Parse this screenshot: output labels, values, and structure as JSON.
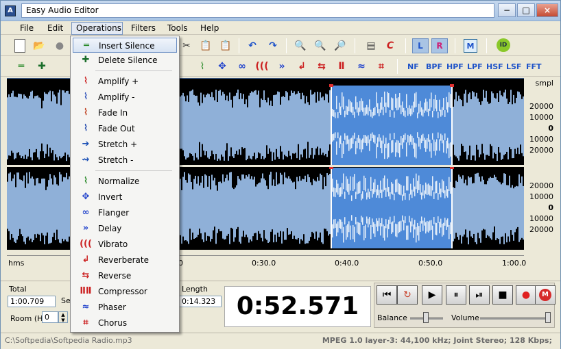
{
  "window": {
    "title": "Easy Audio Editor",
    "app_icon": "A"
  },
  "window_buttons": {
    "minimize": "−",
    "maximize": "□",
    "close": "×"
  },
  "menubar": [
    "File",
    "Edit",
    "Operations",
    "Filters",
    "Tools",
    "Help"
  ],
  "toolbar2_filters": [
    "NF",
    "BPF",
    "HPF",
    "LPF",
    "HSF",
    "LSF",
    "FFT"
  ],
  "channel_buttons": [
    "L",
    "R"
  ],
  "operations_menu": [
    {
      "label": "Insert Silence",
      "icon": "insert-silence-icon",
      "glyph": "═",
      "color": "#2a8a2a"
    },
    {
      "label": "Delete Silence",
      "icon": "delete-silence-icon",
      "glyph": "✚",
      "color": "#1b6e2a"
    },
    {
      "label": "Amplify +",
      "icon": "amplify-plus-icon",
      "glyph": "⌇",
      "color": "#cc2222"
    },
    {
      "label": "Amplify -",
      "icon": "amplify-minus-icon",
      "glyph": "⌇",
      "color": "#3355bb"
    },
    {
      "label": "Fade In",
      "icon": "fade-in-icon",
      "glyph": "⌇",
      "color": "#c04020"
    },
    {
      "label": "Fade Out",
      "icon": "fade-out-icon",
      "glyph": "⌇",
      "color": "#2a4fb0"
    },
    {
      "label": "Stretch +",
      "icon": "stretch-plus-icon",
      "glyph": "➔",
      "color": "#1a4fb5"
    },
    {
      "label": "Stretch -",
      "icon": "stretch-minus-icon",
      "glyph": "⇝",
      "color": "#1a4fb5"
    },
    {
      "label": "Normalize",
      "icon": "normalize-icon",
      "glyph": "⌇",
      "color": "#2a8a2a"
    },
    {
      "label": "Invert",
      "icon": "invert-icon",
      "glyph": "✥",
      "color": "#2244cc"
    },
    {
      "label": "Flanger",
      "icon": "flanger-icon",
      "glyph": "∞",
      "color": "#2244cc"
    },
    {
      "label": "Delay",
      "icon": "delay-icon",
      "glyph": "»",
      "color": "#2244cc"
    },
    {
      "label": "Vibrato",
      "icon": "vibrato-icon",
      "glyph": "(((",
      "color": "#cc2222"
    },
    {
      "label": "Reverberate",
      "icon": "reverberate-icon",
      "glyph": "↲",
      "color": "#cc2222"
    },
    {
      "label": "Reverse",
      "icon": "reverse-icon",
      "glyph": "⇆",
      "color": "#cc2222"
    },
    {
      "label": "Compressor",
      "icon": "compressor-icon",
      "glyph": "ⅡⅡ",
      "color": "#cc2222"
    },
    {
      "label": "Phaser",
      "icon": "phaser-icon",
      "glyph": "≈",
      "color": "#2244cc"
    },
    {
      "label": "Chorus",
      "icon": "chorus-icon",
      "glyph": "⌗",
      "color": "#cc2222"
    }
  ],
  "scale": {
    "unit": "smpl",
    "labels_top": [
      "20000",
      "10000",
      "0",
      "10000",
      "20000"
    ],
    "labels_bottom": [
      "20000",
      "10000",
      "0",
      "10000",
      "20000"
    ]
  },
  "timeline": {
    "unit": "hms",
    "ticks": [
      "0:30.0",
      "0:40.0",
      "0:50.0",
      "1:00.0"
    ],
    "partial_tick": "0"
  },
  "info": {
    "total_label": "Total",
    "total_value": "1:00.709",
    "se_label": "Se",
    "length_label": "Length",
    "length_value": "0:14.323",
    "room_label": "Room (H)",
    "room_value": "0"
  },
  "current_time": "0:52.571",
  "transport": {
    "record_button": "●",
    "m_button": "M",
    "balance_label": "Balance",
    "volume_label": "Volume",
    "balance_level": 0.47,
    "volume_level": 0.97
  },
  "status": {
    "file": "C:\\Softpedia\\Softpedia Radio.mp3",
    "format": "MPEG 1.0 layer-3: 44,100 kHz; Joint Stereo; 128 Kbps;"
  },
  "colors": {
    "wave_bg": "#8fb0d8",
    "wave_sel": "#4e8ad8",
    "wave_dark": "#000000",
    "accent": "#1e53c9"
  }
}
